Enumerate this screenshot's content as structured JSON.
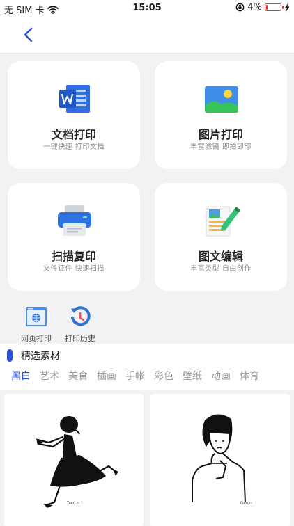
{
  "status_bar": {
    "carrier": "无 SIM 卡",
    "time": "15:05",
    "battery": "4%",
    "battery_level": 0.04,
    "icons": [
      "wifi-icon",
      "orientation-lock-icon",
      "battery-icon",
      "charging-icon"
    ]
  },
  "nav": {
    "back_icon": "chevron-left-icon",
    "accent": "#2d4fd8"
  },
  "cards": [
    {
      "title": "文档打印",
      "subtitle": "一键快速 打印文档",
      "icon": "word-document-icon"
    },
    {
      "title": "图片打印",
      "subtitle": "丰富滤镜 即拍即印",
      "icon": "picture-icon"
    },
    {
      "title": "扫描复印",
      "subtitle": "文件证件 快速扫描",
      "icon": "printer-icon"
    },
    {
      "title": "图文编辑",
      "subtitle": "丰富类型 自由创作",
      "icon": "edit-document-icon"
    }
  ],
  "tools": [
    {
      "label": "网页打印",
      "icon": "web-page-icon"
    },
    {
      "label": "打印历史",
      "icon": "history-icon"
    }
  ],
  "materials": {
    "title": "精选素材",
    "tabs": [
      "黑白",
      "艺术",
      "美食",
      "插画",
      "手帐",
      "彩色",
      "壁纸",
      "动画",
      "体育"
    ],
    "active_tab": "黑白",
    "signature": "Yuan ni"
  }
}
